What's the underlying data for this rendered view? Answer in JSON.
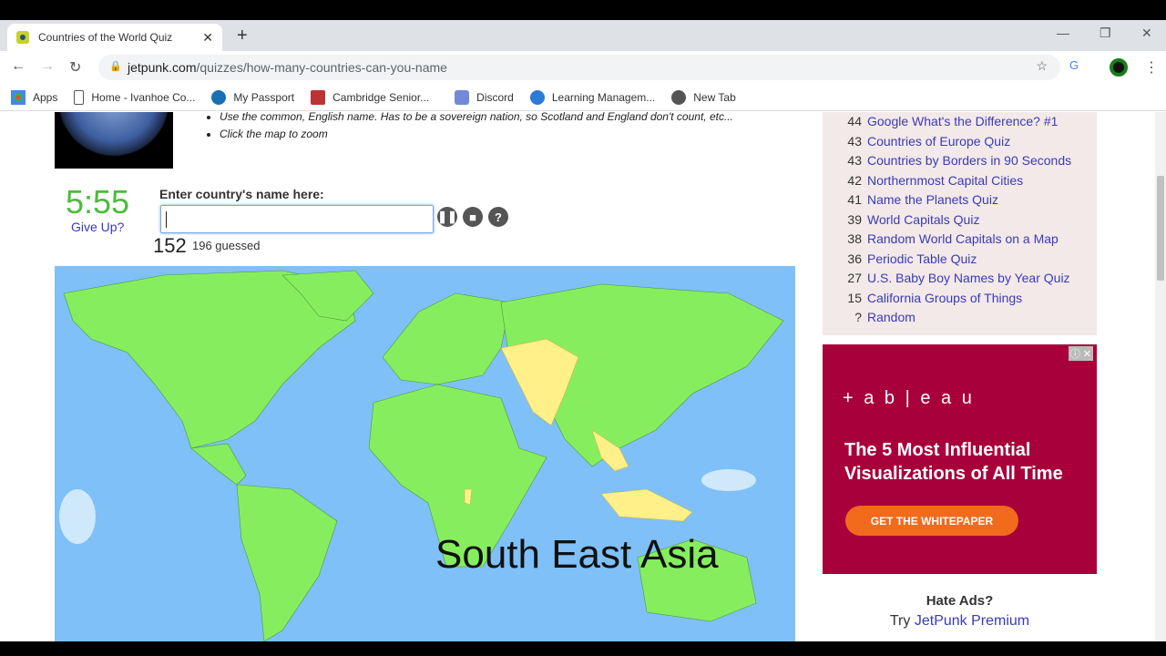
{
  "browser": {
    "tab_title": "Countries of the World Quiz",
    "url_host": "jetpunk.com",
    "url_path": "/quizzes/how-many-countries-can-you-name",
    "bookmarks": [
      "Apps",
      "Home - Ivanhoe Co...",
      "My Passport",
      "Cambridge Senior...",
      "Discord",
      "Learning Managem...",
      "New Tab"
    ]
  },
  "quiz": {
    "instructions": [
      "Use the common, English name. Has to be a sovereign nation, so Scotland and England don't count, etc...",
      "Click the map to zoom"
    ],
    "timer": "5:55",
    "give_up": "Give Up?",
    "prompt": "Enter country's name here:",
    "answer_value": "",
    "score": "152",
    "total_label": "196 guessed",
    "map_label": "South East Asia",
    "colors": {
      "ocean": "#7fc0f8",
      "guessed": "#86ee5e",
      "missing": "#fff08a",
      "timer": "#4cbb3c"
    }
  },
  "sidebar": {
    "items": [
      {
        "n": "44",
        "t": "Google What's the Difference? #1"
      },
      {
        "n": "43",
        "t": "Countries of Europe Quiz"
      },
      {
        "n": "43",
        "t": "Countries by Borders in 90 Seconds"
      },
      {
        "n": "42",
        "t": "Northernmost Capital Cities"
      },
      {
        "n": "41",
        "t": "Name the Planets Quiz"
      },
      {
        "n": "39",
        "t": "World Capitals Quiz"
      },
      {
        "n": "38",
        "t": "Random World Capitals on a Map"
      },
      {
        "n": "36",
        "t": "Periodic Table Quiz"
      },
      {
        "n": "27",
        "t": "U.S. Baby Boy Names by Year Quiz"
      },
      {
        "n": "15",
        "t": "California Groups of Things"
      },
      {
        "n": "?",
        "t": "Random"
      }
    ]
  },
  "ad": {
    "logo": "+ a b | e a u",
    "headline": "The 5 Most Influential Visualizations of All Time",
    "cta": "GET THE WHITEPAPER"
  },
  "premium": {
    "title": "Hate Ads?",
    "try": "Try",
    "link": "JetPunk Premium"
  }
}
